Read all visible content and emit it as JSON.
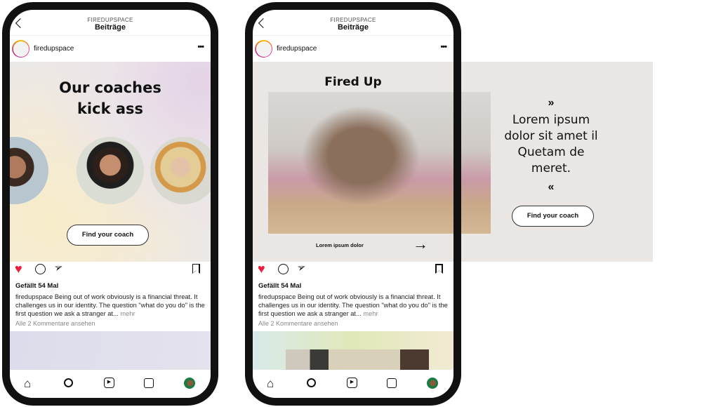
{
  "header": {
    "account": "FIREDUPSPACE",
    "title": "Beiträge"
  },
  "post_user": "firedupspace",
  "colors": {
    "like": "#ed1c3c",
    "panel": "#e9e6e3",
    "frame": "#111111"
  },
  "posts": [
    {
      "headline": "Our coaches kick ass",
      "cta": "Find your coach",
      "likes": "Gefällt 54 Mal",
      "caption_user": "firedupspace",
      "caption": "Being out of work obviously is a financial threat. It challenges us in our identity. The question \"what do you do\" is the first question we ask a stranger at...",
      "more": "mehr",
      "comments": "Alle 2 Kommentare ansehen"
    },
    {
      "headline": "Fired Up Coaches",
      "link": "Lorem ipsum dolor",
      "quote_open": "»",
      "quote": "Lorem ipsum dolor sit amet il Quetam de meret.",
      "quote_close": "«",
      "cta": "Find your coach",
      "likes": "Gefällt 54 Mal",
      "caption_user": "firedupspace",
      "caption": "Being out of work obviously is a financial threat. It challenges us in our identity. The question \"what do you do\" is the first question we ask a stranger at...",
      "more": "mehr",
      "comments": "Alle 2 Kommentare ansehen"
    }
  ],
  "nav": [
    "home-icon",
    "search-icon",
    "reels-icon",
    "shop-icon",
    "profile-avatar"
  ]
}
